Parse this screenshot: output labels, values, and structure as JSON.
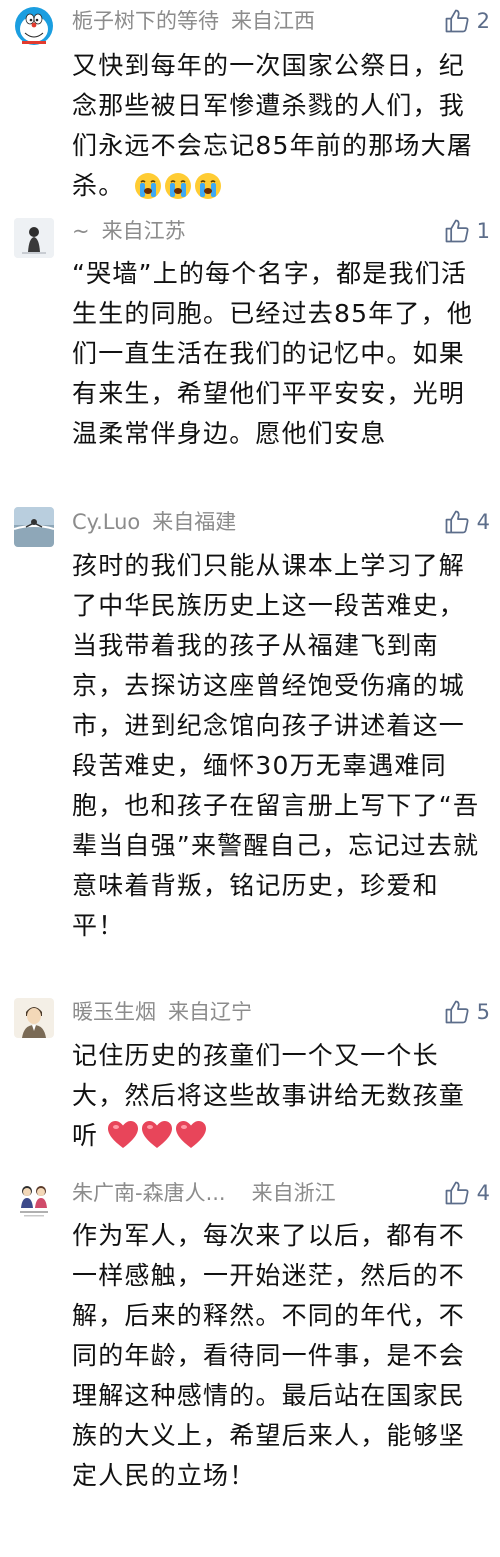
{
  "colors": {
    "meta_text": "#8c8c8c",
    "like_icon": "#5c6d8a",
    "body_text": "#111111",
    "heart": "#e8455a"
  },
  "comments": [
    {
      "username": "栀子树下的等待",
      "location": "来自江西",
      "likes": "2",
      "avatar_icon": "doraemon-avatar",
      "text": "又快到每年的一次国家公祭日，纪念那些被日军惨遭杀戮的人们，我们永远不会忘记85年前的那场大屠杀。",
      "emojis": [
        "crying-emoji",
        "crying-emoji",
        "crying-emoji"
      ]
    },
    {
      "username": "~",
      "location": "来自江苏",
      "likes": "1",
      "avatar_icon": "person-avatar",
      "text": "“哭墙”上的每个名字，都是我们活生生的同胞。已经过去85年了，他们一直生活在我们的记忆中。如果有来生，希望他们平平安安，光明温柔常伴身边。愿他们安息"
    },
    {
      "username": "Cy.Luo",
      "location": "来自福建",
      "likes": "4",
      "avatar_icon": "landscape-avatar",
      "text": "孩时的我们只能从课本上学习了解了中华民族历史上这一段苦难史，当我带着我的孩子从福建飞到南京，去探访这座曾经饱受伤痛的城市，进到纪念馆向孩子讲述着这一段苦难史，缅怀30万无辜遇难同胞，也和孩子在留言册上写下了“吾辈当自强”来警醒自己，忘记过去就意味着背叛，铭记历史，珍爱和平！"
    },
    {
      "username": "暖玉生烟",
      "location": "来自辽宁",
      "likes": "5",
      "avatar_icon": "cartoon-man-avatar",
      "text": "记住历史的孩童们一个又一个长大，然后将这些故事讲给无数孩童听",
      "emojis": [
        "heart-emoji",
        "heart-emoji",
        "heart-emoji"
      ]
    },
    {
      "username": "朱广南-森唐人...",
      "location": "来自浙江",
      "likes": "4",
      "avatar_icon": "couple-avatar",
      "text": "作为军人，每次来了以后，都有不一样感触，一开始迷茫，然后的不解，后来的释然。不同的年代，不同的年龄，看待同一件事，是不会理解这种感情的。最后站在国家民族的大义上，希望后来人，能够坚定人民的立场！"
    }
  ]
}
